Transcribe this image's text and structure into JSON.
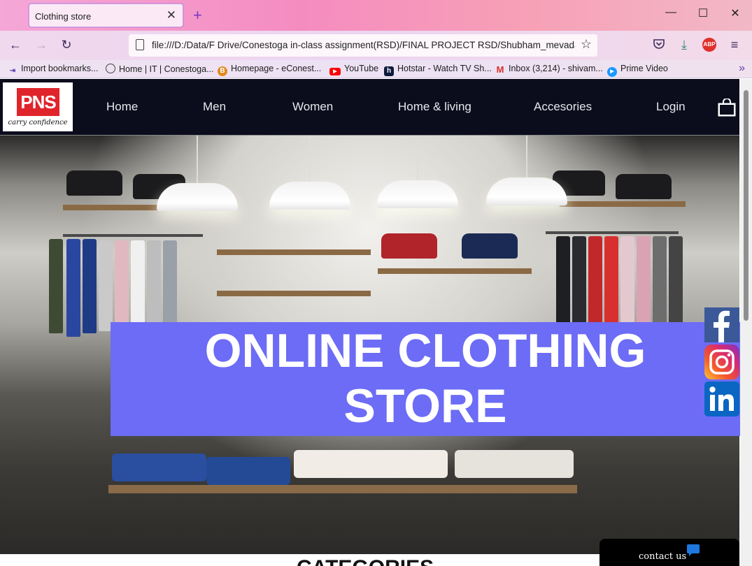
{
  "browser": {
    "tab_title": "Clothing store",
    "tab_close": "✕",
    "new_tab": "+",
    "window_controls": {
      "minimize": "—",
      "maximize": "☐",
      "close": "✕"
    },
    "url": "file:///D:/Data/F Drive/Conestoga in-class assignment(RSD)/FINAL PROJECT RSD/Shubham_mevada",
    "abp_label": "ABP",
    "bookmarks": [
      {
        "label": "Import bookmarks...",
        "icon": "import-icon",
        "color": "#5a3aa8"
      },
      {
        "label": "Home | IT | Conestoga...",
        "icon": "globe-icon",
        "color": "#444444"
      },
      {
        "label": "Homepage - eConest...",
        "icon": "econestoga-icon",
        "color": "#e08a1e"
      },
      {
        "label": "YouTube",
        "icon": "youtube-icon",
        "color": "#ff0000"
      },
      {
        "label": "Hotstar - Watch TV Sh...",
        "icon": "hotstar-icon",
        "color": "#0f1a3c"
      },
      {
        "label": "Inbox (3,214) - shivam...",
        "icon": "gmail-icon",
        "color": "#d93025"
      },
      {
        "label": "Prime Video",
        "icon": "prime-video-icon",
        "color": "#1a98ff"
      }
    ]
  },
  "site": {
    "logo": {
      "brand": "PNS",
      "tagline": "carry confidence"
    },
    "menu": [
      "Home",
      "Men",
      "Women",
      "Home & living",
      "Accesories",
      "Login"
    ],
    "banner_line1": "ONLINE CLOTHING",
    "banner_line2": "STORE",
    "contact_label": "contact us",
    "section_heading": "CATEGORIES",
    "social": [
      "facebook-icon",
      "instagram-icon",
      "linkedin-icon"
    ]
  },
  "colors": {
    "header_bg": "#0b0c1c",
    "banner_bg": "#6c6cf6",
    "logo_red": "#e0242b"
  }
}
